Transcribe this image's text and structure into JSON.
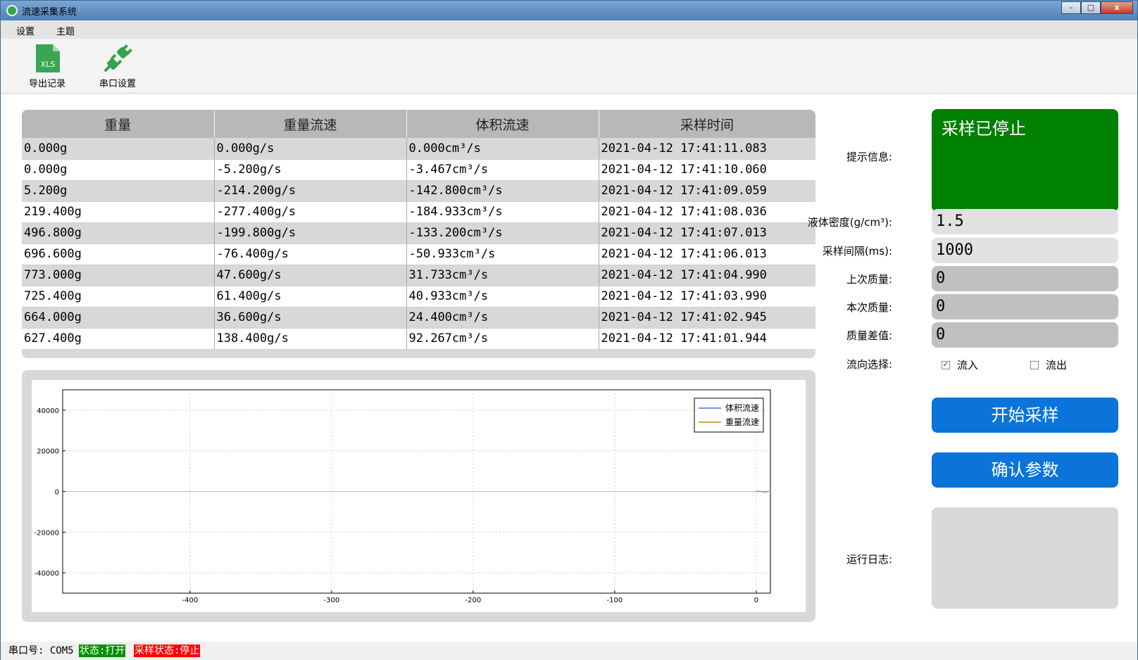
{
  "window": {
    "title": "流速采集系统",
    "min_label": "–",
    "max_label": "□",
    "close_label": "x"
  },
  "menu": {
    "items": [
      "设置",
      "主题"
    ]
  },
  "toolbar": {
    "export": {
      "label": "导出记录",
      "icon": "xls-file-icon",
      "icon_text": "XLS"
    },
    "serial": {
      "label": "串口设置",
      "icon": "plug-icon"
    }
  },
  "table": {
    "headers": [
      "重量",
      "重量流速",
      "体积流速",
      "采样时间"
    ],
    "rows": [
      [
        "0.000g",
        "0.000g/s",
        "0.000cm³/s",
        "2021-04-12 17:41:11.083"
      ],
      [
        "0.000g",
        "-5.200g/s",
        "-3.467cm³/s",
        "2021-04-12 17:41:10.060"
      ],
      [
        "5.200g",
        "-214.200g/s",
        "-142.800cm³/s",
        "2021-04-12 17:41:09.059"
      ],
      [
        "219.400g",
        "-277.400g/s",
        "-184.933cm³/s",
        "2021-04-12 17:41:08.036"
      ],
      [
        "496.800g",
        "-199.800g/s",
        "-133.200cm³/s",
        "2021-04-12 17:41:07.013"
      ],
      [
        "696.600g",
        "-76.400g/s",
        "-50.933cm³/s",
        "2021-04-12 17:41:06.013"
      ],
      [
        "773.000g",
        "47.600g/s",
        "31.733cm³/s",
        "2021-04-12 17:41:04.990"
      ],
      [
        "725.400g",
        "61.400g/s",
        "40.933cm³/s",
        "2021-04-12 17:41:03.990"
      ],
      [
        "664.000g",
        "36.600g/s",
        "24.400cm³/s",
        "2021-04-12 17:41:02.945"
      ],
      [
        "627.400g",
        "138.400g/s",
        "92.267cm³/s",
        "2021-04-12 17:41:01.944"
      ]
    ]
  },
  "chart_data": {
    "type": "line",
    "xlim": [
      -490,
      10
    ],
    "ylim": [
      -50000,
      50000
    ],
    "x_ticks": [
      -400,
      -300,
      -200,
      -100,
      0
    ],
    "y_ticks": [
      40000,
      20000,
      0,
      -20000,
      -40000
    ],
    "grid": true,
    "legend_position": "top-right",
    "series": [
      {
        "name": "体积流速",
        "color": "#3a7bd5",
        "x": [
          0,
          1,
          2,
          3,
          4,
          5,
          6,
          7,
          8,
          9
        ],
        "y": [
          92.267,
          24.4,
          40.933,
          31.733,
          -50.933,
          -133.2,
          -184.933,
          -142.8,
          -3.467,
          0
        ]
      },
      {
        "name": "重量流速",
        "color": "#c8860a",
        "x": [
          0,
          1,
          2,
          3,
          4,
          5,
          6,
          7,
          8,
          9
        ],
        "y": [
          138.4,
          36.6,
          61.4,
          47.6,
          -76.4,
          -199.8,
          -277.4,
          -214.2,
          -5.2,
          0
        ]
      }
    ]
  },
  "panel": {
    "info_label": "提示信息:",
    "info_text": "采样已停止",
    "density_label": "液体密度(g/cm³):",
    "density_value": "1.5",
    "interval_label": "采样间隔(ms):",
    "interval_value": "1000",
    "last_mass_label": "上次质量:",
    "last_mass_value": "0",
    "current_mass_label": "本次质量:",
    "current_mass_value": "0",
    "diff_label": "质量差值:",
    "diff_value": "0",
    "direction_label": "流向选择:",
    "inflow_label": "流入",
    "inflow_checked": true,
    "outflow_label": "流出",
    "outflow_checked": false,
    "start_button": "开始采样",
    "confirm_button": "确认参数",
    "log_label": "运行日志:"
  },
  "status": {
    "port": "串口号: COM5",
    "state": "状态:打开",
    "sampling": "采样状态:停止"
  },
  "colors": {
    "info_bg": "#008000",
    "button_bg": "#0a74da",
    "status_green": "#009000",
    "status_red": "#ff0000"
  }
}
